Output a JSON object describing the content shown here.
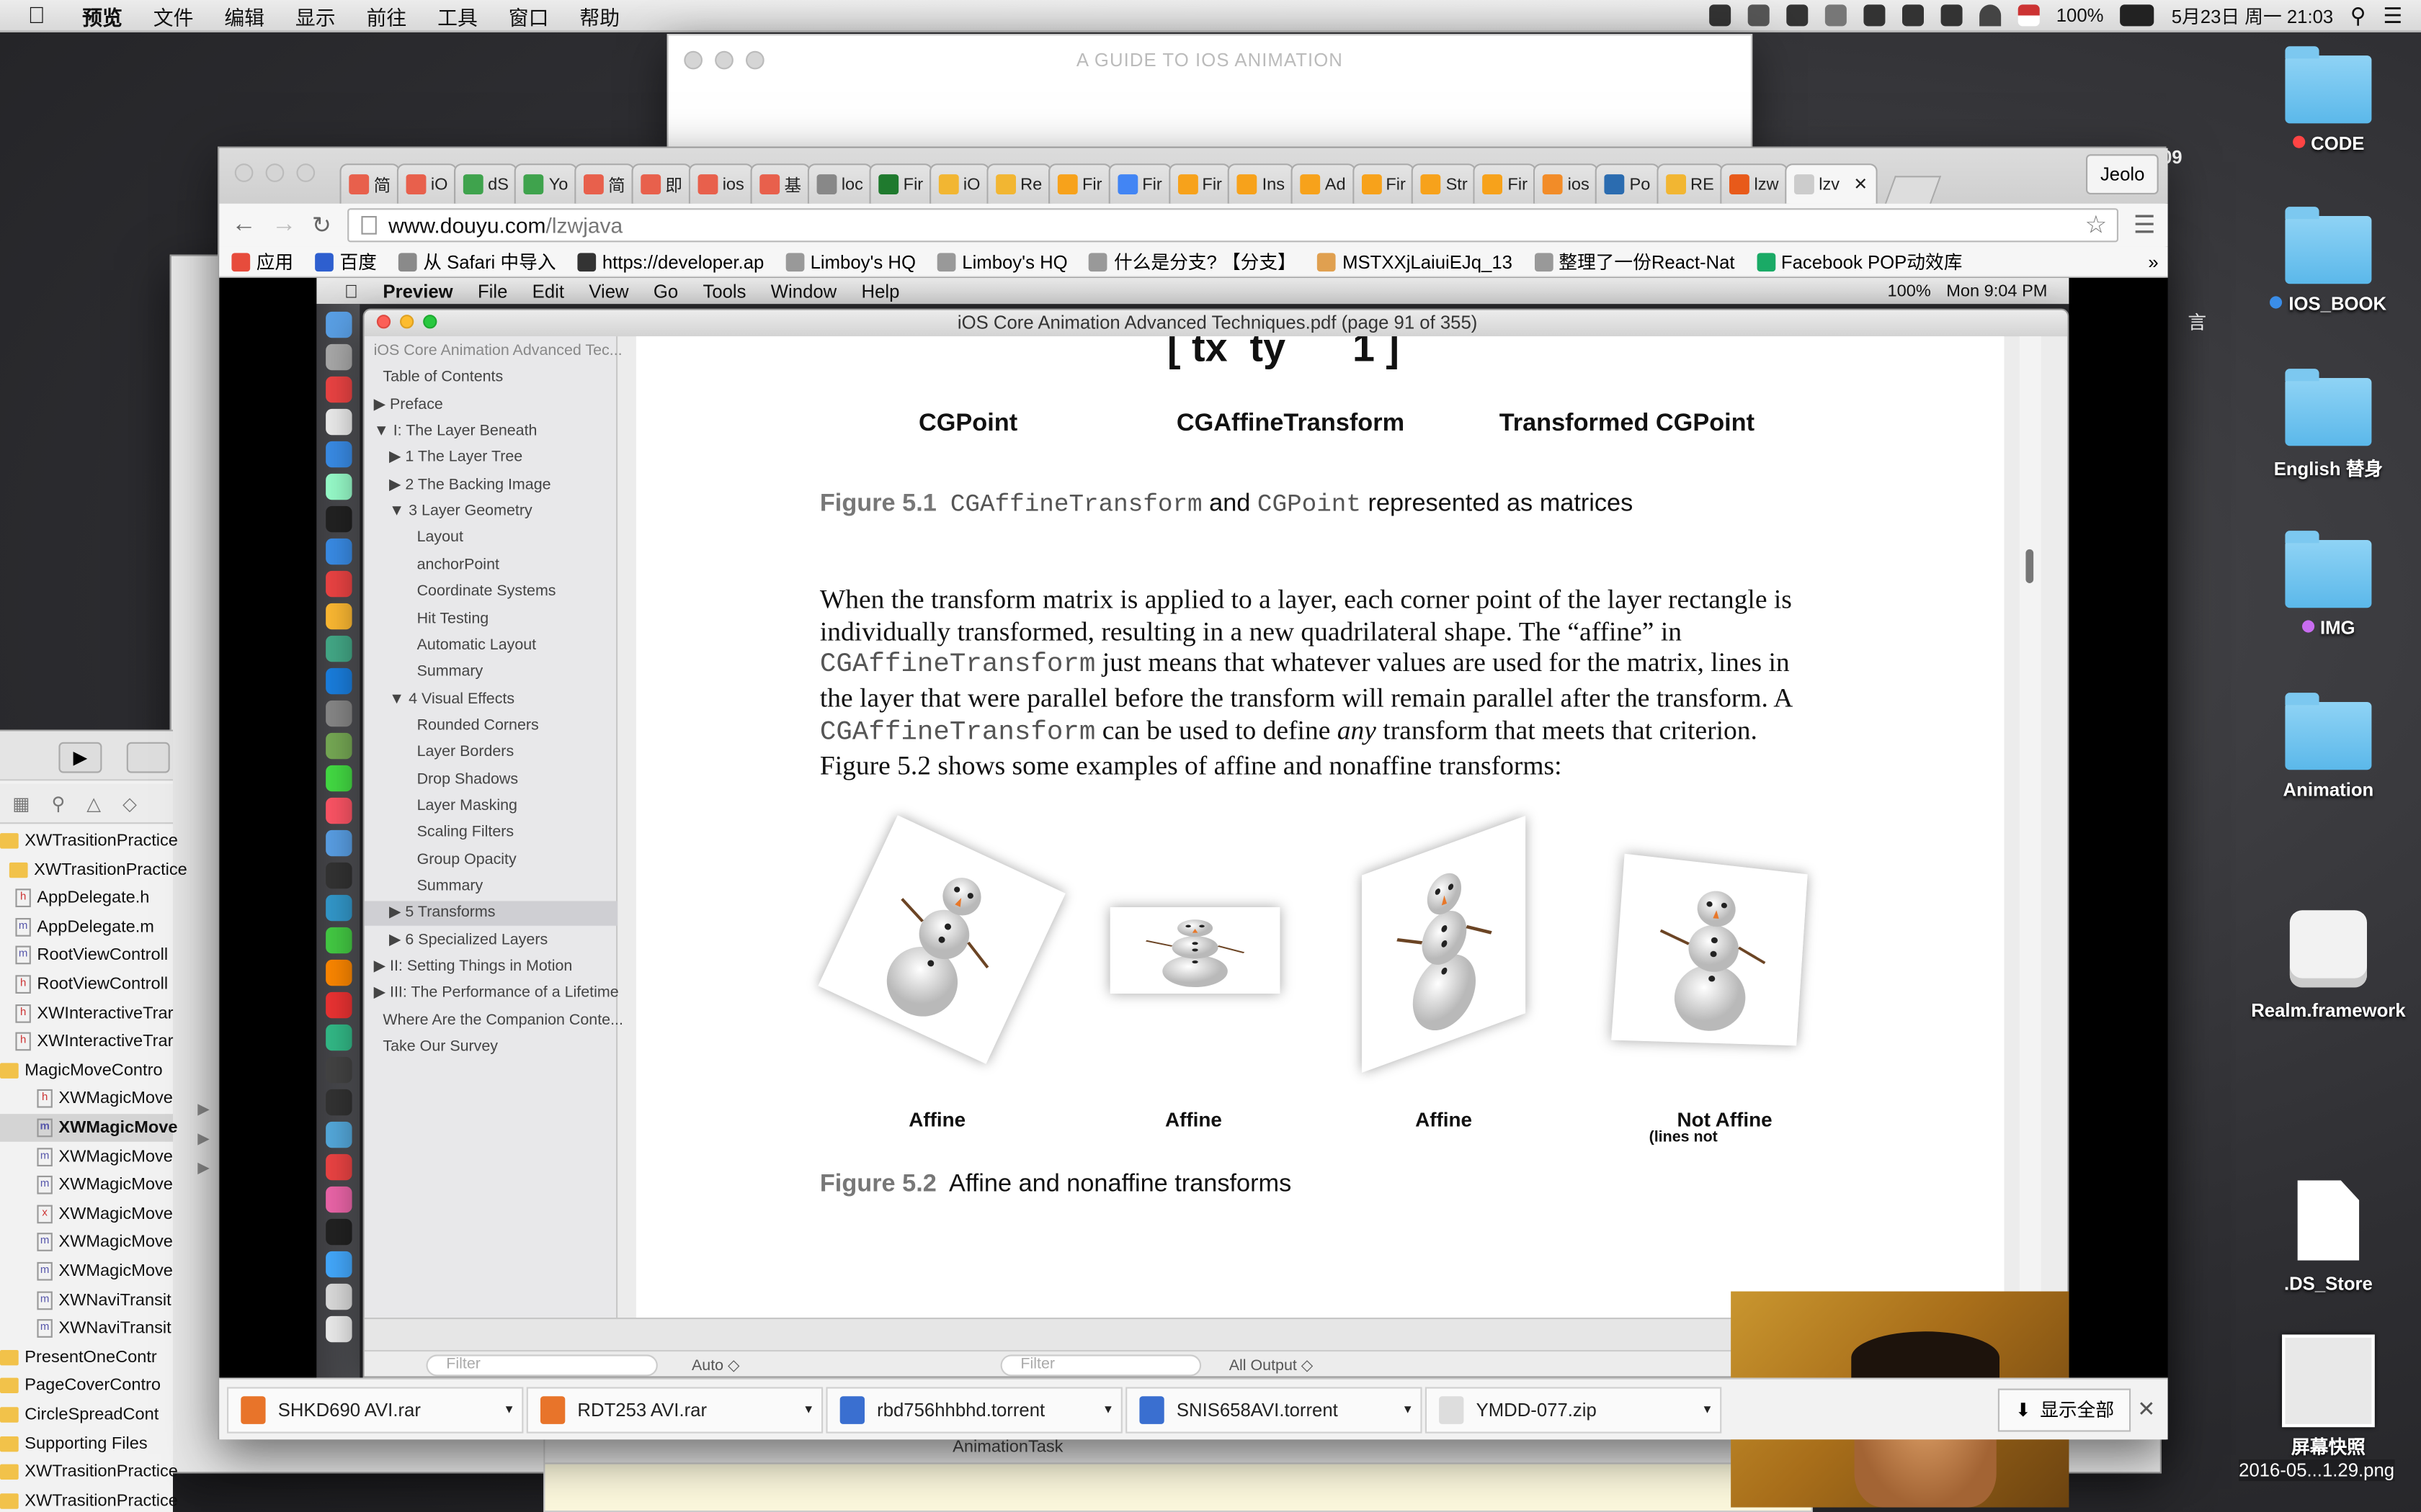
{
  "menubar": {
    "app": "预览",
    "menus": [
      "文件",
      "编辑",
      "显示",
      "前往",
      "工具",
      "窗口",
      "帮助"
    ],
    "battery": "100%",
    "datetime": "5月23日 周一 21:03"
  },
  "desktop": {
    "icons": [
      {
        "label": "CODE",
        "tag": "#f44"
      },
      {
        "label": "IOS_BOOK",
        "tag": "#3a8de8"
      },
      {
        "label": "English 替身",
        "tag": ""
      },
      {
        "label": "IMG",
        "tag": "#c86cf0"
      },
      {
        "label": "Animation",
        "tag": ""
      },
      {
        "label": "Realm.framework",
        "tag": ""
      },
      {
        "label": ".DS_Store",
        "tag": ""
      },
      {
        "label": "屏幕快照",
        "tag": ""
      }
    ],
    "screenshot_name": "2016-05...1.29.png",
    "edge_text_09": "09",
    "edge_text_yan": "言"
  },
  "bg_window_title": "A GUIDE TO IOS ANIMATION",
  "chrome": {
    "tabs": [
      "简",
      "iO",
      "dS",
      "Yo",
      "简",
      "即",
      "ios",
      "基",
      "loc",
      "Fir",
      "iO",
      "Re",
      "Fir",
      "Fir",
      "Fir",
      "Ins",
      "Ad",
      "Fir",
      "Str",
      "Fir",
      "ios",
      "Po",
      "RE",
      "lzw",
      "lzv"
    ],
    "profile": "Jeolo",
    "url_host": "www.douyu.com",
    "url_path": "/lzwjava",
    "bookmarks": [
      "应用",
      "百度",
      "从 Safari 中导入",
      "https://developer.ap",
      "Limboy's HQ",
      "Limboy's HQ",
      "什么是分支? 【分支】",
      "MSTXXjLaiuiEJq_13",
      "整理了一份React-Nat",
      "Facebook POP动效库"
    ]
  },
  "inner": {
    "menubar": {
      "app": "Preview",
      "menus": [
        "File",
        "Edit",
        "View",
        "Go",
        "Tools",
        "Window",
        "Help"
      ],
      "battery": "100%",
      "time": "Mon 9:04 PM"
    },
    "window_title": "iOS Core Animation Advanced Techniques.pdf (page 91 of 355)",
    "toc": [
      "iOS Core Animation Advanced Tec...",
      "Table of Contents",
      "▶ Preface",
      "▼ I: The Layer Beneath",
      "▶ 1 The Layer Tree",
      "▶ 2 The Backing Image",
      "▼ 3 Layer Geometry",
      "Layout",
      "anchorPoint",
      "Coordinate Systems",
      "Hit Testing",
      "Automatic Layout",
      "Summary",
      "▼ 4 Visual Effects",
      "Rounded Corners",
      "Layer Borders",
      "Drop Shadows",
      "Layer Masking",
      "Scaling Filters",
      "Group Opacity",
      "Summary",
      "▶ 5 Transforms",
      "▶ 6 Specialized Layers",
      "▶ II: Setting Things in Motion",
      "▶ III: The Performance of a Lifetime",
      "Where Are the Companion Conte...",
      "Take Our Survey"
    ],
    "page": {
      "matrix_frag": "[ tx  ty      1 ]",
      "col_labels": [
        "CGPoint",
        "CGAffineTransform",
        "Transformed CGPoint"
      ],
      "fig1_num": "Figure 5.1",
      "fig1_a": "CGAffineTransform",
      "fig1_and": " and ",
      "fig1_b": "CGPoint",
      "fig1_rest": " represented as matrices",
      "p1": "When the transform matrix is applied to a layer, each corner point of the layer rectangle is individually transformed, resulting in a new quadrilateral shape. The “affine” in ",
      "p_code1": "CGAffineTransform",
      "p2": " just means that whatever values are used for the matrix, lines in the layer that were parallel before the transform will remain parallel after the transform. A ",
      "p_code2": "CGAffineTransform",
      "p3": " can be used to define ",
      "p_any": "any",
      "p4": " transform that meets that criterion. Figure 5.2 shows some examples of affine and nonaffine transforms:",
      "snow_labels": [
        "Affine",
        "Affine",
        "Affine",
        "Not Affine"
      ],
      "snow_sub": "(lines not",
      "fig2_num": "Figure 5.2",
      "fig2_text": "Affine and nonaffine transforms"
    },
    "bottom": {
      "filter1": "Filter",
      "auto": "Auto ◇",
      "filter2": "Filter",
      "all_output": "All Output ◇"
    }
  },
  "downloads": [
    {
      "name": "SHKD690 AVI.rar",
      "color": "#e8742a"
    },
    {
      "name": "RDT253 AVI.rar",
      "color": "#e8742a"
    },
    {
      "name": "rbd756hhbhd.torrent",
      "color": "#3a6fd0"
    },
    {
      "name": "SNIS658AVI.torrent",
      "color": "#3a6fd0"
    },
    {
      "name": "YMDD-077.zip",
      "color": "#dddddd"
    }
  ],
  "show_all": "显示全部",
  "xcode": {
    "files": [
      "XWTrasitionPractice",
      "XWTrasitionPractice",
      "AppDelegate.h",
      "AppDelegate.m",
      "RootViewControll",
      "RootViewControll",
      "XWInteractiveTrar",
      "XWInteractiveTrar",
      "MagicMoveContro",
      "XWMagicMove",
      "XWMagicMove",
      "XWMagicMove",
      "XWMagicMove",
      "XWMagicMove",
      "XWMagicMove",
      "XWMagicMove",
      "XWNaviTransit",
      "XWNaviTransit",
      "PresentOneContr",
      "PageCoverContro",
      "CircleSpreadCont",
      "Supporting Files",
      "XWTrasitionPractice",
      "XWTrasitionPractice"
    ],
    "tabbar_text": "AnimationTask"
  }
}
